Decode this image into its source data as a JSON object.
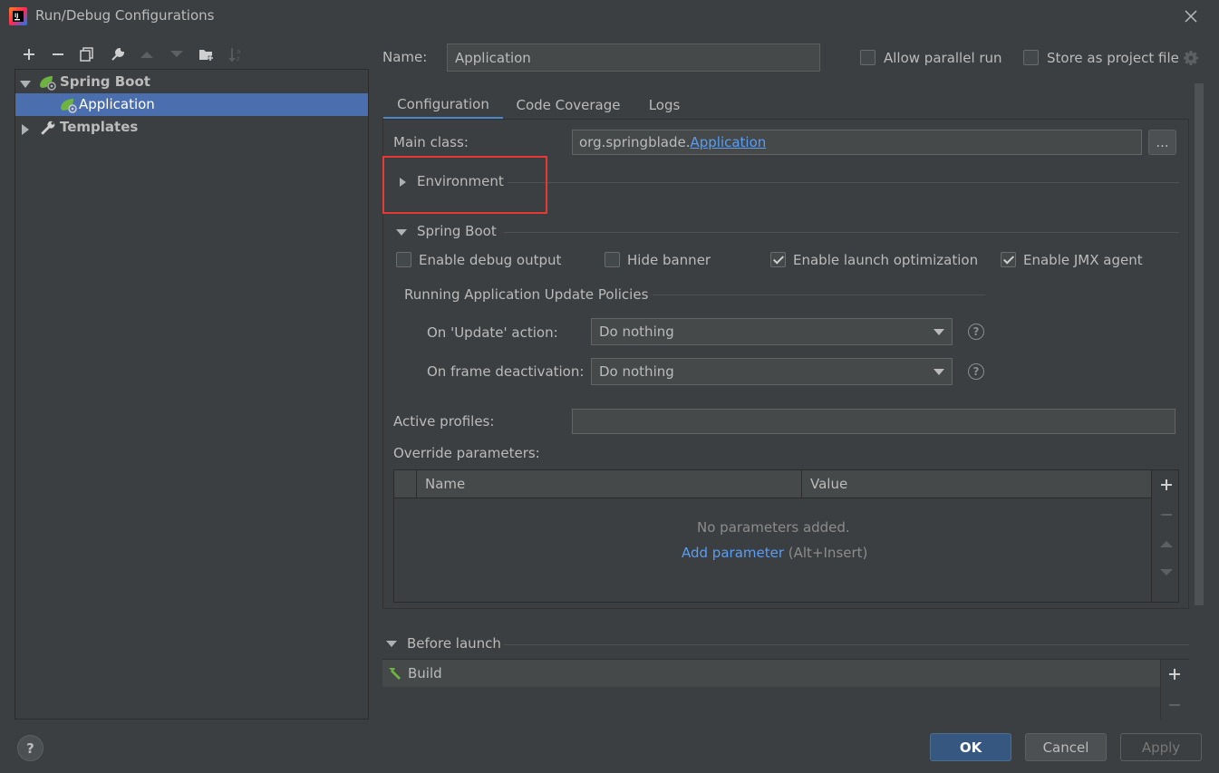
{
  "window": {
    "title": "Run/Debug Configurations"
  },
  "tree": {
    "groups": [
      {
        "label": "Spring Boot",
        "children": [
          {
            "label": "Application"
          }
        ]
      },
      {
        "label": "Templates"
      }
    ]
  },
  "name_field": {
    "label": "Name:",
    "value": "Application"
  },
  "options": {
    "allow_parallel_run": {
      "label": "Allow parallel run",
      "checked": false
    },
    "store_as_project_file": {
      "label": "Store as project file",
      "checked": false
    }
  },
  "tabs": [
    {
      "label": "Configuration",
      "active": true
    },
    {
      "label": "Code Coverage",
      "active": false
    },
    {
      "label": "Logs",
      "active": false
    }
  ],
  "config": {
    "main_class_label": "Main class:",
    "main_class_prefix": "org.springblade.",
    "main_class_link": "Application",
    "browse_label": "...",
    "environment_label": "Environment",
    "spring_boot_label": "Spring Boot",
    "checkboxes": [
      {
        "label": "Enable debug output",
        "checked": false
      },
      {
        "label": "Hide banner",
        "checked": false
      },
      {
        "label": "Enable launch optimization",
        "checked": true
      },
      {
        "label": "Enable JMX agent",
        "checked": true
      }
    ],
    "policies_title": "Running Application Update Policies",
    "on_update_label": "On 'Update' action:",
    "on_update_value": "Do nothing",
    "on_frame_label": "On frame deactivation:",
    "on_frame_value": "Do nothing",
    "active_profiles_label": "Active profiles:",
    "active_profiles_value": "",
    "override_label": "Override parameters:",
    "table": {
      "columns": [
        "Name",
        "Value"
      ],
      "empty_text": "No parameters added.",
      "add_link": "Add parameter",
      "add_shortcut": "(Alt+Insert)"
    }
  },
  "before_launch": {
    "label": "Before launch",
    "items": [
      {
        "label": "Build"
      }
    ]
  },
  "buttons": {
    "ok": "OK",
    "cancel": "Cancel",
    "apply": "Apply",
    "help": "?"
  },
  "colors": {
    "background": "#3c3f41",
    "selection": "#4b6eaf",
    "accent": "#4a88c7",
    "link": "#589df6",
    "highlight_box": "#e53935",
    "spring_green": "#6db33f"
  }
}
